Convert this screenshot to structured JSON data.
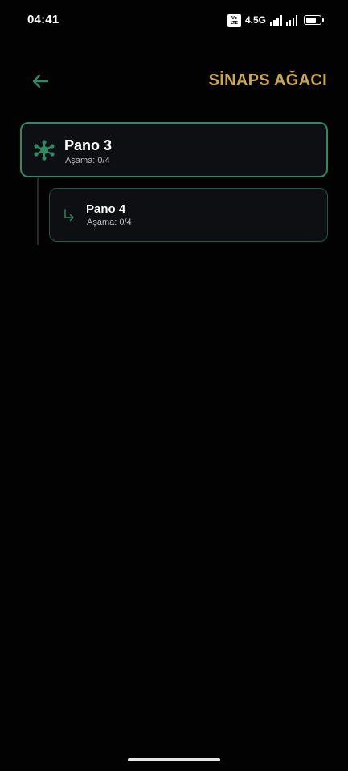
{
  "status_bar": {
    "time": "04:41",
    "volte": "Vo LTE",
    "network": "4.5G",
    "signal_bars_1": 4,
    "signal_bars_2": 4,
    "battery_level": 0.8
  },
  "header": {
    "title": "SİNAPS AĞACI",
    "back_icon": "arrow-left-icon"
  },
  "tree": {
    "root": {
      "title": "Pano 3",
      "stage": "Aşama: 0/4",
      "icon": "network-hub-icon"
    },
    "children": [
      {
        "title": "Pano 4",
        "stage": "Aşama: 0/4",
        "icon": "subdirectory-arrow-right-icon"
      }
    ]
  },
  "colors": {
    "background": "#020203",
    "accent_green": "#2f8a64",
    "title_gold": "#c9a74e",
    "card_bg": "#0e0f12",
    "muted_text": "#b9bbbf"
  }
}
